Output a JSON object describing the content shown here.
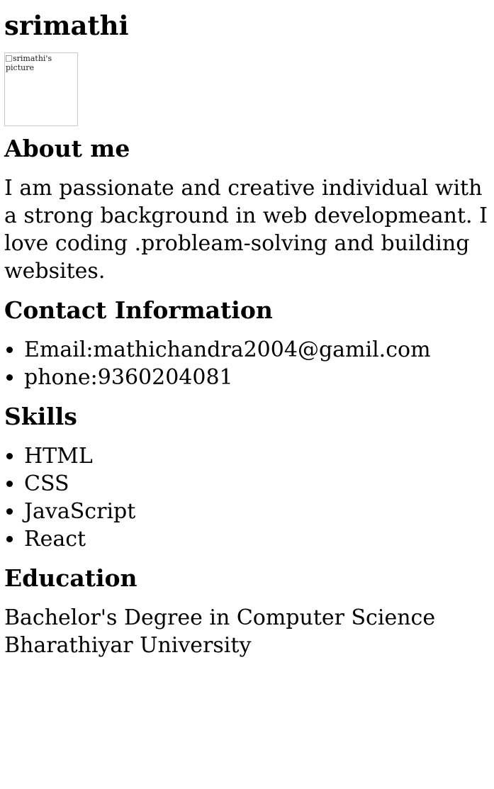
{
  "page": {
    "name": "srimathi"
  },
  "profile_image": {
    "alt_text": "srimathi's picture"
  },
  "about": {
    "heading": "About me",
    "text": "I am passionate and creative individual with a strong background in web developmeant. I love coding .probleam-solving and building websites."
  },
  "contact": {
    "heading": "Contact Information",
    "items": [
      "Email:mathichandra2004@gamil.com",
      "phone:9360204081"
    ]
  },
  "skills": {
    "heading": "Skills",
    "items": [
      "HTML",
      "CSS",
      "JavaScript",
      "React"
    ]
  },
  "education": {
    "heading": "Education",
    "degree": "Bachelor's Degree in Computer Science",
    "university": "Bharathiyar University"
  }
}
